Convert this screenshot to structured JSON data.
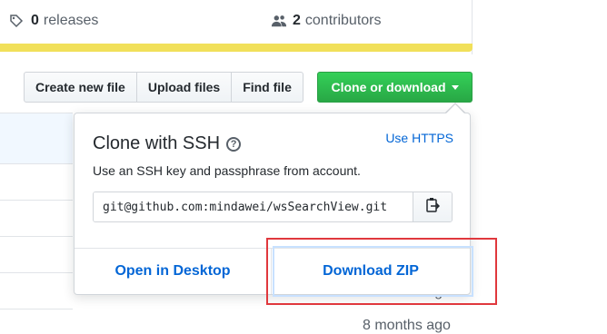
{
  "stats": {
    "releases_count": "0",
    "releases_label": "releases",
    "contributors_count": "2",
    "contributors_label": "contributors"
  },
  "toolbar": {
    "create_new_file": "Create new file",
    "upload_files": "Upload files",
    "find_file": "Find file",
    "clone_or_download": "Clone or download"
  },
  "clone_popup": {
    "title": "Clone with SSH",
    "switch_link": "Use HTTPS",
    "description": "Use an SSH key and passphrase from account.",
    "url": "git@github.com:mindawei/wsSearchView.git",
    "open_desktop": "Open in Desktop",
    "download_zip": "Download ZIP"
  },
  "file_list": {
    "time_partial": "8 months ago",
    "time_last": "8 months ago"
  },
  "colors": {
    "accent_green": "#28a745",
    "link_blue": "#0366d6",
    "language_bar": "#f1e05a",
    "highlight_red": "#e0383d"
  }
}
